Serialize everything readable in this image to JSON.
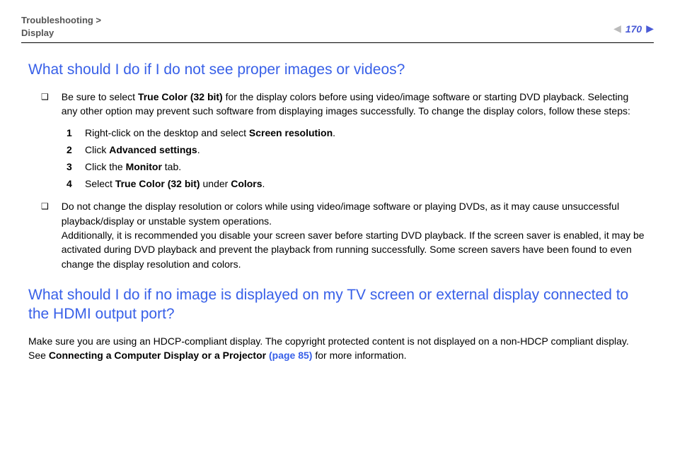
{
  "header": {
    "breadcrumb_top": "Troubleshooting >",
    "breadcrumb_sub": "Display",
    "page_number": "170"
  },
  "sections": {
    "q1": {
      "heading": "What should I do if I do not see proper images or videos?",
      "bullet1": {
        "pre": "Be sure to select ",
        "bold1": "True Color (32 bit)",
        "post1": " for the display colors before using video/image software or starting DVD playback. Selecting any other option may prevent such software from displaying images successfully. To change the display colors, follow these steps:"
      },
      "steps": {
        "s1": {
          "num": "1",
          "pre": "Right-click on the desktop and select ",
          "bold": "Screen resolution",
          "post": "."
        },
        "s2": {
          "num": "2",
          "pre": "Click ",
          "bold": "Advanced settings",
          "post": "."
        },
        "s3": {
          "num": "3",
          "pre": "Click the ",
          "bold": "Monitor",
          "post": " tab."
        },
        "s4": {
          "num": "4",
          "pre": "Select ",
          "bold": "True Color (32 bit)",
          "mid": " under ",
          "bold2": "Colors",
          "post": "."
        }
      },
      "bullet2": {
        "line1": "Do not change the display resolution or colors while using video/image software or playing DVDs, as it may cause unsuccessful playback/display or unstable system operations.",
        "line2": "Additionally, it is recommended you disable your screen saver before starting DVD playback. If the screen saver is enabled, it may be activated during DVD playback and prevent the playback from running successfully. Some screen savers have been found to even change the display resolution and colors."
      }
    },
    "q2": {
      "heading": "What should I do if no image is displayed on my TV screen or external display connected to the HDMI output port?",
      "para": {
        "pre": "Make sure you are using an HDCP-compliant display. The copyright protected content is not displayed on a non-HDCP compliant display. See ",
        "bold": "Connecting a Computer Display or a Projector ",
        "linkref": "(page 85)",
        "post": " for more information."
      }
    }
  }
}
